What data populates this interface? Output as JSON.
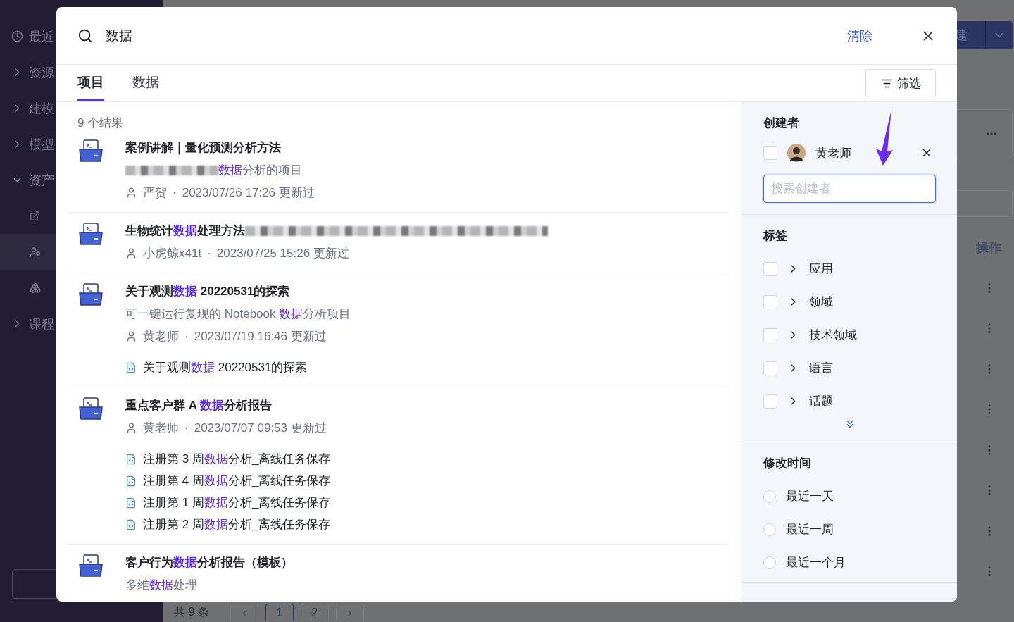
{
  "background": {
    "sidebar": [
      {
        "kind": "clock",
        "label": "最近",
        "expanded": false
      },
      {
        "kind": "branch",
        "label": "资源",
        "expanded": false
      },
      {
        "kind": "branch",
        "label": "建模",
        "expanded": false
      },
      {
        "kind": "branch",
        "label": "模型",
        "expanded": false
      },
      {
        "kind": "branch",
        "label": "资产",
        "expanded": true
      },
      {
        "kind": "share",
        "selected": false
      },
      {
        "kind": "person",
        "selected": true
      },
      {
        "kind": "boxes",
        "selected": false
      },
      {
        "kind": "branch",
        "label": "课程",
        "expanded": false
      }
    ],
    "create_button": "建",
    "column_header": "操作",
    "total": "共 9 条",
    "pages": [
      {
        "label": "‹",
        "kind": "arrow",
        "selected": false
      },
      {
        "label": "1",
        "kind": "page",
        "selected": true
      },
      {
        "label": "2",
        "kind": "page",
        "selected": false
      },
      {
        "label": "›",
        "kind": "arrow",
        "selected": false
      }
    ]
  },
  "dialog": {
    "query": "数据",
    "clear": "清除",
    "tabs": [
      {
        "label": "项目",
        "selected": true
      },
      {
        "label": "数据",
        "selected": false
      }
    ],
    "filter_button": "筛选",
    "result_count": "9 个结果",
    "results": [
      {
        "title": [
          {
            "text": "案例讲解｜量化预测分析方法"
          }
        ],
        "title_redacted": false,
        "description": [
          {
            "text": "数据",
            "highlight": true
          },
          {
            "text": "分析的项目"
          }
        ],
        "description_redacted": true,
        "author": "严贺",
        "separator": "·",
        "updated": "2023/07/26 17:26 更新过"
      },
      {
        "title": [
          {
            "text": "生物统计"
          },
          {
            "text": "数据",
            "highlight": true
          },
          {
            "text": "处理方法"
          }
        ],
        "title_redacted": true,
        "author": "小虎鲸x41t",
        "separator": "·",
        "updated": "2023/07/25 15:26 更新过"
      },
      {
        "title": [
          {
            "text": "关于观测"
          },
          {
            "text": "数据",
            "highlight": true
          },
          {
            "text": " 20220531的探索"
          }
        ],
        "title_redacted": false,
        "description": [
          {
            "text": "可一键运行复现的 Notebook "
          },
          {
            "text": "数据",
            "highlight": true
          },
          {
            "text": "分析项目"
          }
        ],
        "description_redacted": false,
        "author": "黄老师",
        "separator": "·",
        "updated": "2023/07/19 16:46 更新过",
        "files": [
          [
            {
              "text": "关于观测"
            },
            {
              "text": "数据",
              "highlight": true
            },
            {
              "text": " 20220531的探索"
            }
          ]
        ]
      },
      {
        "title": [
          {
            "text": "重点客户群 A "
          },
          {
            "text": "数据",
            "highlight": true
          },
          {
            "text": "分析报告"
          }
        ],
        "title_redacted": false,
        "author": "黄老师",
        "separator": "·",
        "updated": "2023/07/07 09:53 更新过",
        "files": [
          [
            {
              "text": "注册第 3 周"
            },
            {
              "text": "数据",
              "highlight": true
            },
            {
              "text": "分析_离线任务保存"
            }
          ],
          [
            {
              "text": "注册第 4 周"
            },
            {
              "text": "数据",
              "highlight": true
            },
            {
              "text": "分析_离线任务保存"
            }
          ],
          [
            {
              "text": "注册第 1 周"
            },
            {
              "text": "数据",
              "highlight": true
            },
            {
              "text": "分析_离线任务保存"
            }
          ],
          [
            {
              "text": "注册第 2 周"
            },
            {
              "text": "数据",
              "highlight": true
            },
            {
              "text": "分析_离线任务保存"
            }
          ]
        ]
      },
      {
        "title": [
          {
            "text": "客户行为"
          },
          {
            "text": "数据",
            "highlight": true
          },
          {
            "text": "分析报告（模板）"
          }
        ],
        "title_redacted": false,
        "description": [
          {
            "text": "多维"
          },
          {
            "text": "数据",
            "highlight": true
          },
          {
            "text": "处理"
          }
        ],
        "description_redacted": false
      }
    ],
    "filters": {
      "creator_title": "创建者",
      "creators": [
        {
          "name": "黄老师",
          "checked": false
        }
      ],
      "creator_search": {
        "placeholder": "搜索创建者"
      },
      "tags_title": "标签",
      "tags": [
        {
          "label": "应用",
          "checked": false
        },
        {
          "label": "领域",
          "checked": false
        },
        {
          "label": "技术领域",
          "checked": false
        },
        {
          "label": "语言",
          "checked": false
        },
        {
          "label": "话题",
          "checked": false
        }
      ],
      "time_title": "修改时间",
      "times": [
        {
          "label": "最近一天",
          "selected": false
        },
        {
          "label": "最近一周",
          "selected": false
        },
        {
          "label": "最近一个月",
          "selected": false
        }
      ]
    }
  }
}
